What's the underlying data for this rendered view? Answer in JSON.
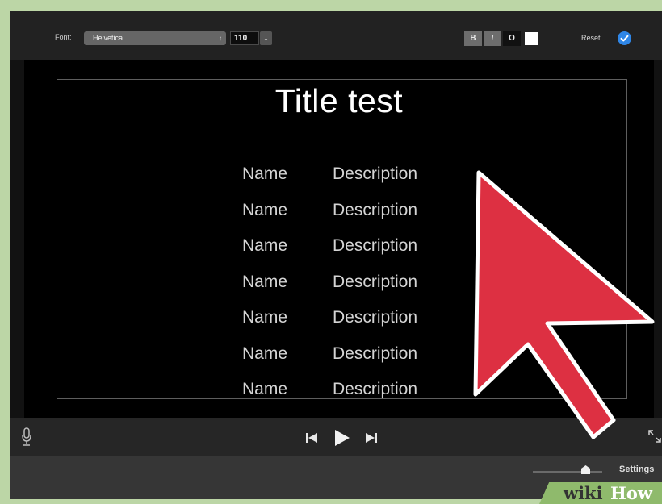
{
  "toolbar": {
    "font_label": "Font:",
    "font_value": "Helvetica",
    "size_value": "110",
    "bold_label": "B",
    "italic_label": "I",
    "outline_label": "O",
    "reset_label": "Reset",
    "text_color": "#ffffff",
    "check_color": "#2f86e6"
  },
  "viewer": {
    "title": "Title test",
    "credits": [
      {
        "name": "Name",
        "description": "Description"
      },
      {
        "name": "Name",
        "description": "Description"
      },
      {
        "name": "Name",
        "description": "Description"
      },
      {
        "name": "Name",
        "description": "Description"
      },
      {
        "name": "Name",
        "description": "Description"
      },
      {
        "name": "Name",
        "description": "Description"
      },
      {
        "name": "Name",
        "description": "Description"
      }
    ]
  },
  "transport": {
    "icons": [
      "microphone-icon",
      "skip-back-icon",
      "play-icon",
      "skip-forward-icon",
      "fullscreen-icon"
    ]
  },
  "bottom_bar": {
    "settings_label": "Settings"
  },
  "overlay": {
    "arrow_color": "#dd3042",
    "watermark_wiki": "wiki",
    "watermark_how": "How"
  }
}
